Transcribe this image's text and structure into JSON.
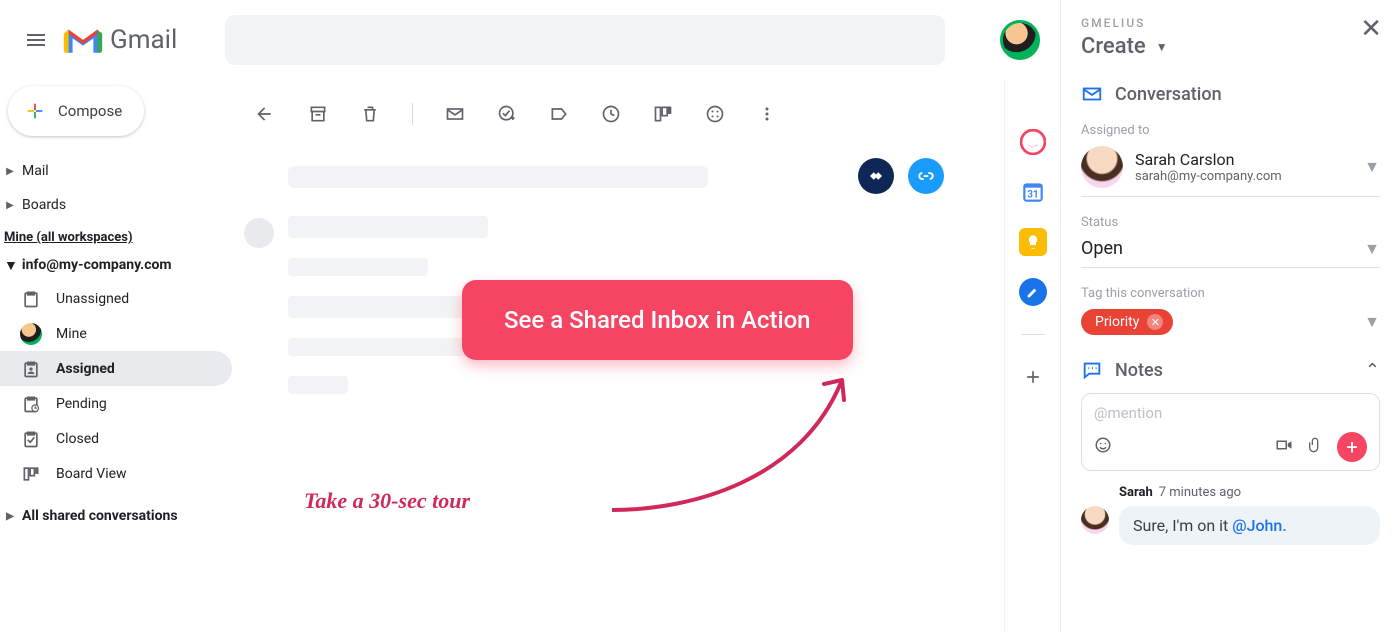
{
  "header": {
    "app_name": "Gmail",
    "compose_label": "Compose"
  },
  "sidebar": {
    "mail_label": "Mail",
    "boards_label": "Boards",
    "workspaces_label": "Mine (all workspaces)",
    "inbox_group": "info@my-company.com",
    "items": [
      {
        "label": "Unassigned"
      },
      {
        "label": "Mine"
      },
      {
        "label": "Assigned"
      },
      {
        "label": "Pending"
      },
      {
        "label": "Closed"
      },
      {
        "label": "Board View"
      }
    ],
    "all_shared_label": "All shared conversations"
  },
  "cta": {
    "button": "See a Shared Inbox in Action",
    "note": "Take a 30-sec tour"
  },
  "gmelius": {
    "brand": "GMELIUS",
    "create_label": "Create",
    "conversation_title": "Conversation",
    "assigned_label": "Assigned to",
    "assignee_name": "Sarah Carslon",
    "assignee_email": "sarah@my-company.com",
    "status_label": "Status",
    "status_value": "Open",
    "tag_label": "Tag this conversation",
    "tag_value": "Priority",
    "notes_title": "Notes",
    "notes_placeholder": "@mention",
    "note_author": "Sarah",
    "note_time": "7 minutes ago",
    "note_text": "Sure, I'm on it ",
    "note_mention": "@John."
  }
}
